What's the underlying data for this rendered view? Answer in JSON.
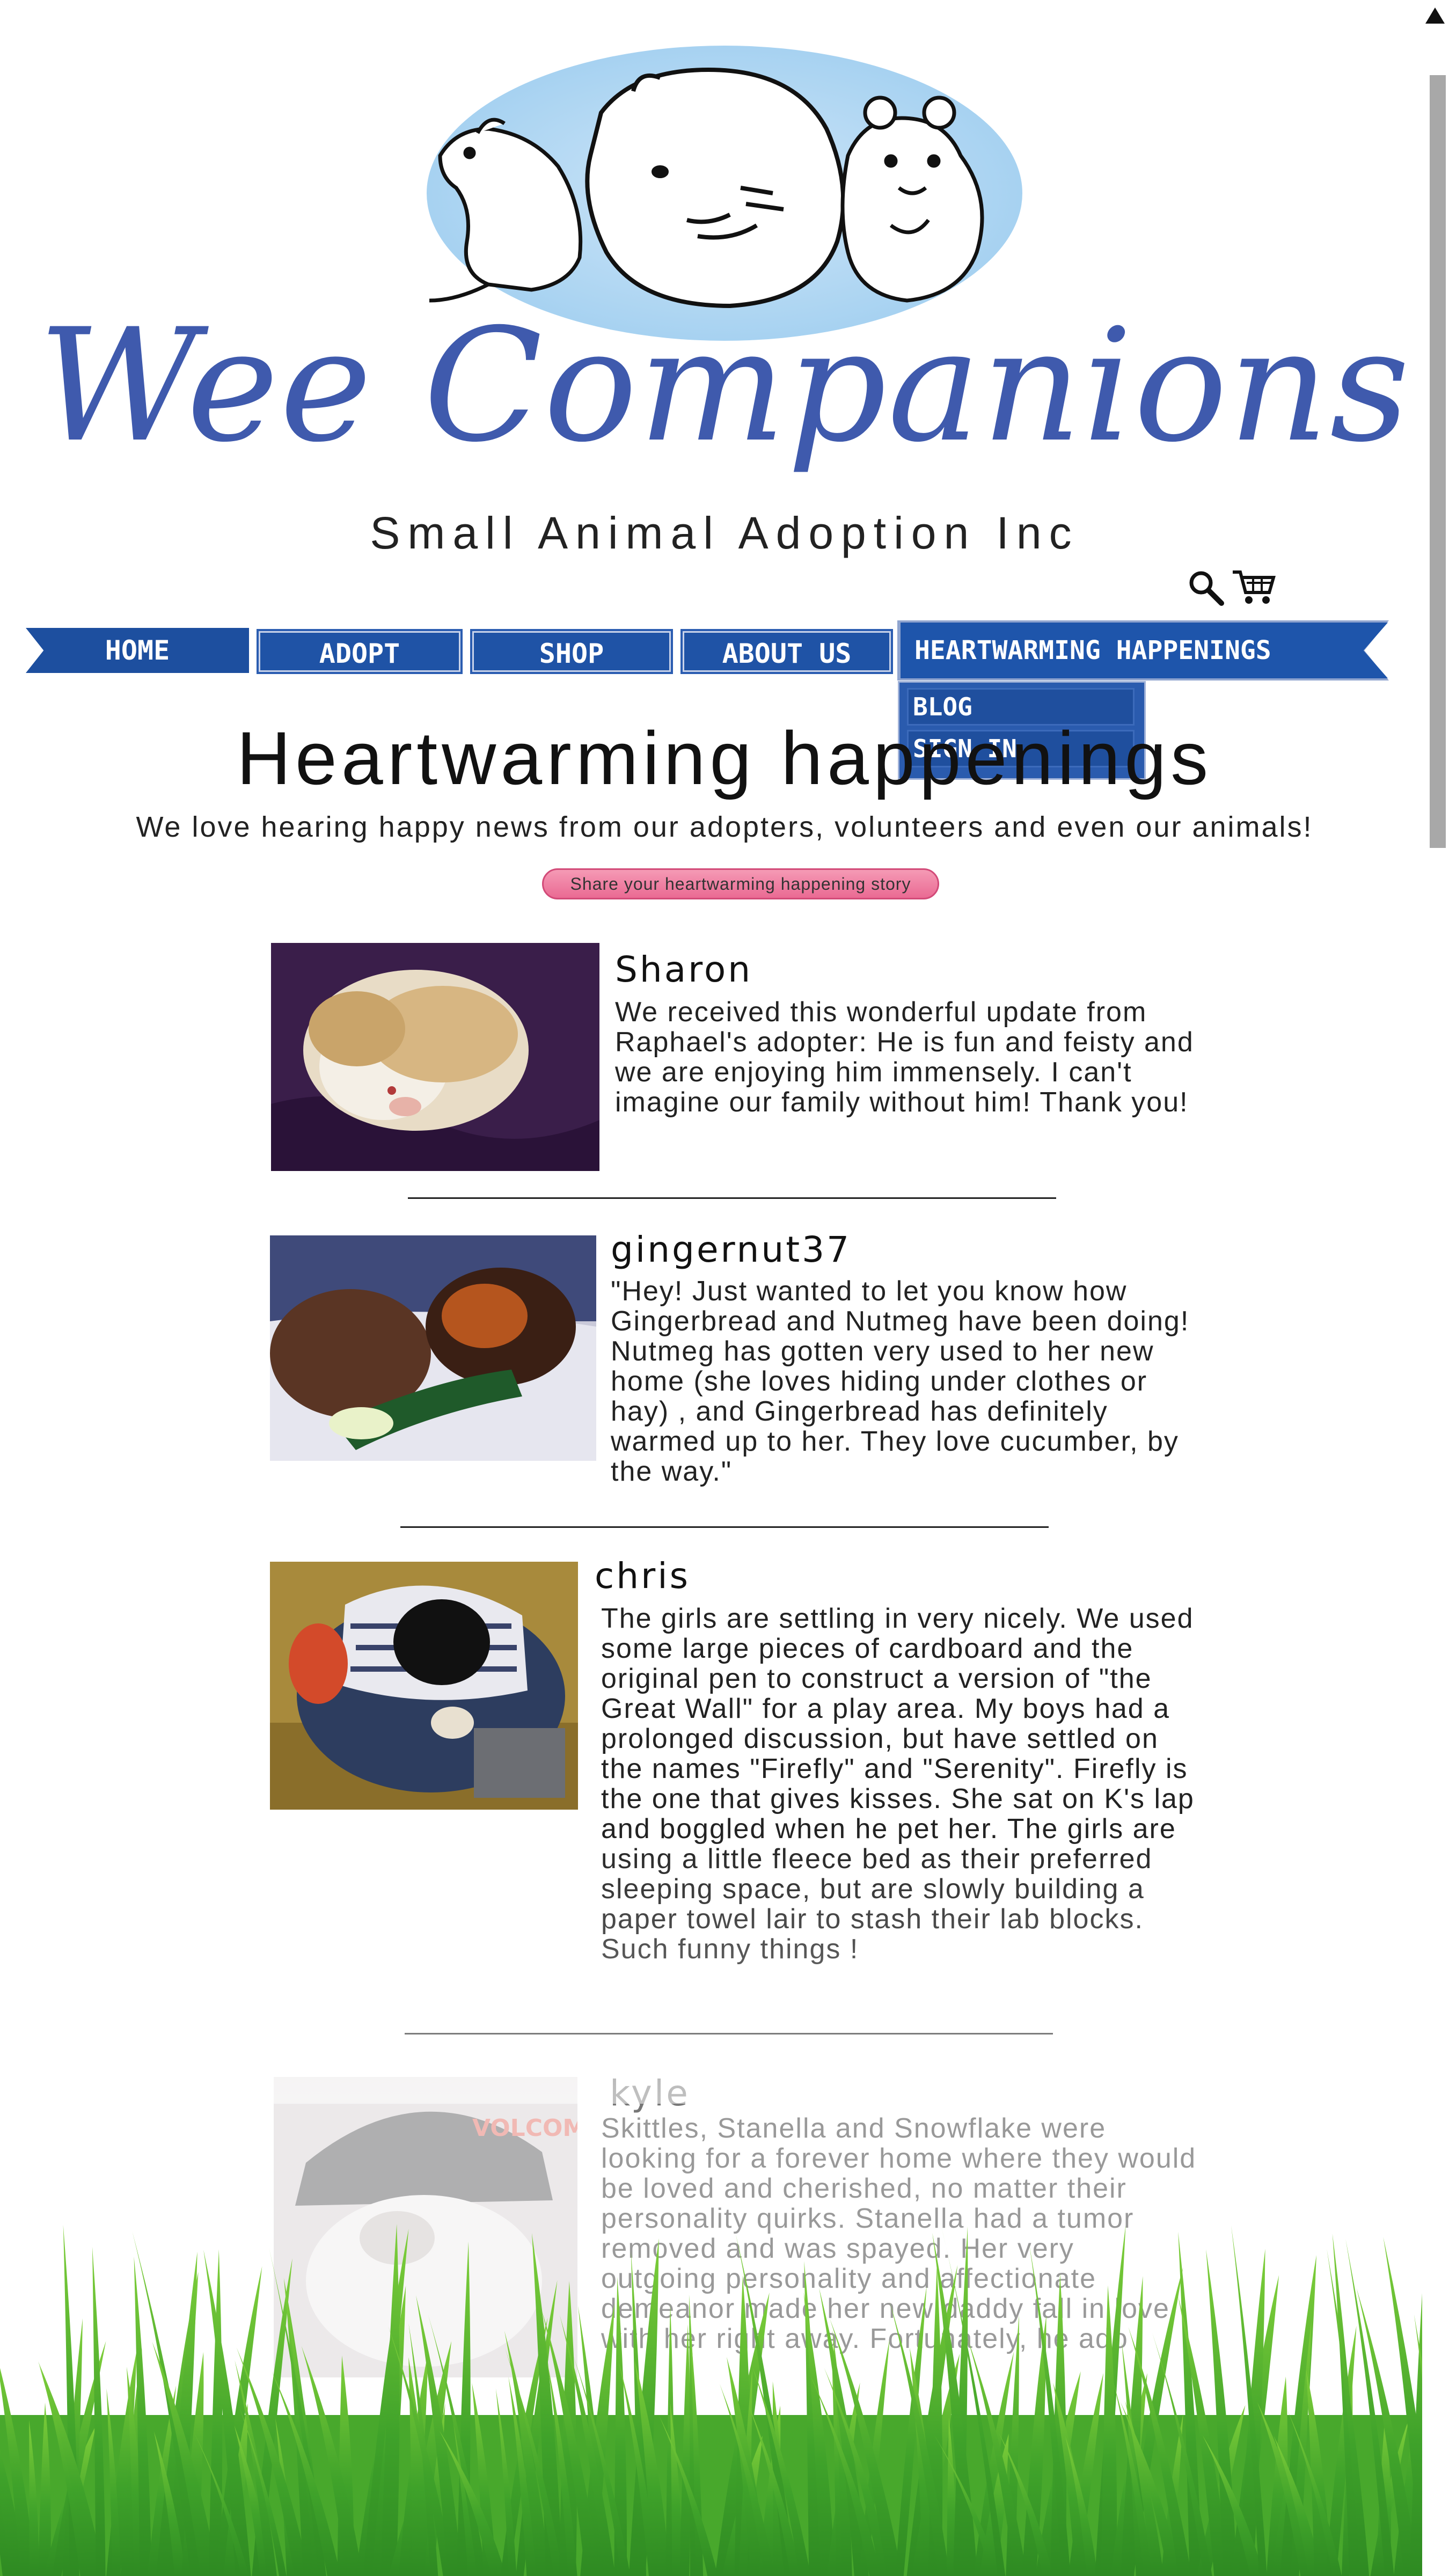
{
  "brand": {
    "title": "Wee Companions",
    "subtitle": "Small Animal Adoption Inc"
  },
  "icons": {
    "search": "search-icon",
    "cart": "cart-icon"
  },
  "edge_letter": "s",
  "nav": {
    "items": [
      {
        "label": "HOME"
      },
      {
        "label": "ADOPT"
      },
      {
        "label": "SHOP"
      },
      {
        "label": "ABOUT US"
      },
      {
        "label": "HEARTWARMING HAPPENINGS"
      }
    ],
    "dropdown": [
      {
        "label": "BLOG"
      },
      {
        "label": "SIGN IN"
      }
    ]
  },
  "page": {
    "title": "Heartwarming happenings",
    "intro": "We love hearing happy news from our adopters, volunteers and even our animals!",
    "share_label": "Share your heartwarming happening story"
  },
  "stories": [
    {
      "name": "Sharon",
      "text": "We received this wonderful update from Raphael's adopter: He is fun and feisty and we are enjoying him immensely. I can't imagine our family without him! Thank you!"
    },
    {
      "name": "gingernut37",
      "text": "\"Hey! Just wanted to let you know how Gingerbread and Nutmeg have been doing! Nutmeg has gotten very used to her new home (she loves hiding under clothes or hay) , and Gingerbread has definitely warmed up to her. They love cucumber, by the way.\""
    },
    {
      "name": "chris",
      "text": "The girls are settling in very nicely. We used some large pieces of cardboard and the original pen to construct a version of \"the Great Wall\" for a play area.  My boys had a prolonged discussion, but have settled on the names \"Firefly\" and \"Serenity\".  Firefly is the one that gives kisses. She sat on K's lap and boggled when he pet her. The girls are using a little fleece bed as their preferred sleeping space, but are slowly building a paper towel lair to stash their lab blocks.  Such funny things !"
    },
    {
      "name": "kyle",
      "text": "Skittles, Stanella and Snowflake were looking for a forever home where they would be loved and cherished, no matter their personality quirks. Stanella had a tumor removed and was spayed. Her very outgoing personality and affectionate demeanor made her new daddy fall in love with her right away. Fortunately, he ado"
    }
  ],
  "colors": {
    "brand_blue": "#3f5aad",
    "nav_blue": "#1f53a6",
    "share_pink": "#ea6a93",
    "logo_sky": "#a7d2f1",
    "grass_green": "#4aa82a"
  }
}
